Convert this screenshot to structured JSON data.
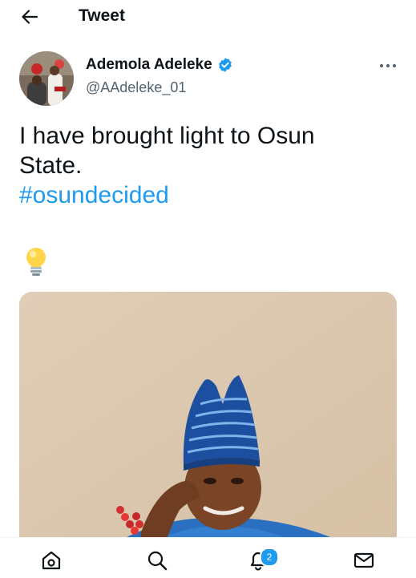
{
  "header": {
    "title": "Tweet"
  },
  "author": {
    "name": "Ademola Adeleke",
    "handle": "@AAdeleke_01",
    "verified": true
  },
  "tweet": {
    "line1": "I have brought light to Osun",
    "line2": "State.",
    "hashtag": "#osundecided",
    "emoji": "light-bulb-icon"
  },
  "nav": {
    "items": [
      "home-icon",
      "search-icon",
      "notifications-icon",
      "messages-icon"
    ],
    "notifications_badge": "2"
  },
  "colors": {
    "accent": "#1d9bf0",
    "text": "#0f1419",
    "muted": "#536471",
    "photo_background": "#dccab2"
  }
}
